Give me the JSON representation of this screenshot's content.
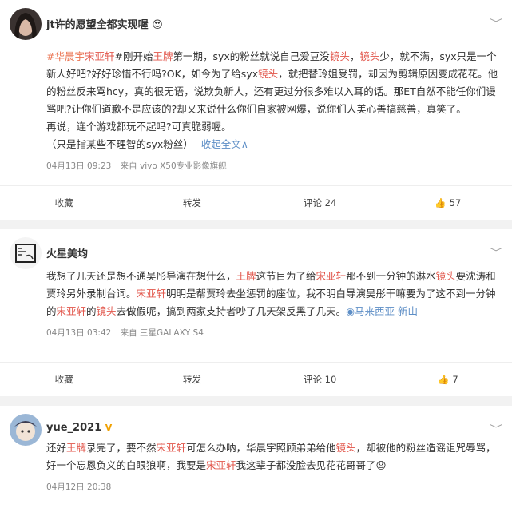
{
  "posts": [
    {
      "user": "jt许的愿望全都实现喔",
      "badge": "😍",
      "segments": [
        {
          "t": "#华晨宇",
          "c": "blue"
        },
        {
          "t": "宋亚轩",
          "c": "red"
        },
        {
          "t": "#刚开始",
          "c": ""
        },
        {
          "t": "王牌",
          "c": "red"
        },
        {
          "t": "第一期，syx的粉丝就说自己爱豆没",
          "c": ""
        },
        {
          "t": "镜头",
          "c": "red"
        },
        {
          "t": "，",
          "c": ""
        },
        {
          "t": "镜头",
          "c": "red"
        },
        {
          "t": "少，就不满，syx只是一个新人好吧?好好珍惜不行吗?OK，如今为了给syx",
          "c": ""
        },
        {
          "t": "镜头",
          "c": "red"
        },
        {
          "t": "，就把替玲姐受罚，却因为剪辑原因变成花花。他的粉丝反来骂hcy，真的很无语，说欺负新人，还有更过分很多难以入耳的话。那ET自然不能任你们谩骂吧?让你们道歉不是应该的?却又来说什么你们自家被网爆，说你们人美心善搞慈善，真笑了。",
          "c": ""
        }
      ],
      "line2": "再说，连个游戏都玩不起吗?可真脆弱喔。",
      "line3": "（只是指某些不理智的syx粉丝）",
      "fold": "收起全文∧",
      "date": "04月13日 09:23",
      "source": "来自 vivo X50专业影像旗舰",
      "collect": "收藏",
      "repost": "转发",
      "comments": "评论 24",
      "likes": "57"
    },
    {
      "user": "火星美均",
      "badge": "",
      "segments": [
        {
          "t": "我想了几天还是想不通吴彤导演在想什么，",
          "c": ""
        },
        {
          "t": "王牌",
          "c": "red"
        },
        {
          "t": "这节目为了给",
          "c": ""
        },
        {
          "t": "宋亚轩",
          "c": "red"
        },
        {
          "t": "那不到一分钟的淋水",
          "c": ""
        },
        {
          "t": "镜头",
          "c": "red"
        },
        {
          "t": "要沈涛和贾玲另外录制台词。",
          "c": ""
        },
        {
          "t": "宋亚轩",
          "c": "red"
        },
        {
          "t": "明明是帮贾玲去坐惩罚的座位，我不明白导演吴彤干嘛要为了这不到一分钟的",
          "c": ""
        },
        {
          "t": "宋亚轩",
          "c": "red"
        },
        {
          "t": "的",
          "c": ""
        },
        {
          "t": "镜头",
          "c": "red"
        },
        {
          "t": "去做假呢，搞到两家支持者吵了几天架反黑了几天。",
          "c": ""
        },
        {
          "t": "◉马来西亚 新山",
          "c": "loc"
        }
      ],
      "date": "04月13日 03:42",
      "source": "来自 三星GALAXY S4",
      "collect": "收藏",
      "repost": "转发",
      "comments": "评论 10",
      "likes": "7"
    },
    {
      "user": "yue_2021",
      "badge": "V",
      "segments": [
        {
          "t": "还好",
          "c": ""
        },
        {
          "t": "王牌",
          "c": "red"
        },
        {
          "t": "录完了，要不然",
          "c": ""
        },
        {
          "t": "宋亚轩",
          "c": "red"
        },
        {
          "t": "可怎么办呐，华晨宇照顾弟弟给他",
          "c": ""
        },
        {
          "t": "镜头",
          "c": "red"
        },
        {
          "t": "，却被他的粉丝造谣诅咒辱骂，好一个忘恩负义的白眼狼啊，我要是",
          "c": ""
        },
        {
          "t": "宋亚轩",
          "c": "red"
        },
        {
          "t": "我这辈子都没脸去见花花哥哥了😧",
          "c": ""
        }
      ],
      "date": "04月12日 20:38"
    }
  ]
}
